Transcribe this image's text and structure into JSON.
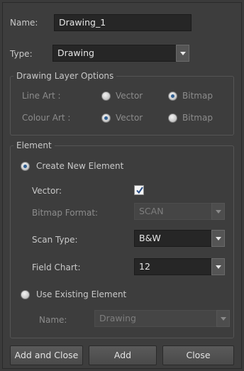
{
  "name_label": "Name:",
  "name_value": "Drawing_1",
  "type_label": "Type:",
  "type_value": "Drawing",
  "drawing_layer_options": {
    "title": "Drawing Layer Options",
    "line_art_label": "Line Art :",
    "colour_art_label": "Colour Art :",
    "vector_label": "Vector",
    "bitmap_label": "Bitmap",
    "line_art_selected": "Bitmap",
    "colour_art_selected": "Vector"
  },
  "element": {
    "title": "Element",
    "create_new_label": "Create New Element",
    "vector_label": "Vector:",
    "vector_checked": true,
    "bitmap_format_label": "Bitmap Format:",
    "bitmap_format_value": "SCAN",
    "scan_type_label": "Scan Type:",
    "scan_type_value": "B&W",
    "field_chart_label": "Field Chart:",
    "field_chart_value": "12",
    "use_existing_label": "Use Existing Element",
    "existing_name_label": "Name:",
    "existing_name_value": "Drawing"
  },
  "buttons": {
    "add_and_close": "Add and Close",
    "add": "Add",
    "close": "Close"
  }
}
